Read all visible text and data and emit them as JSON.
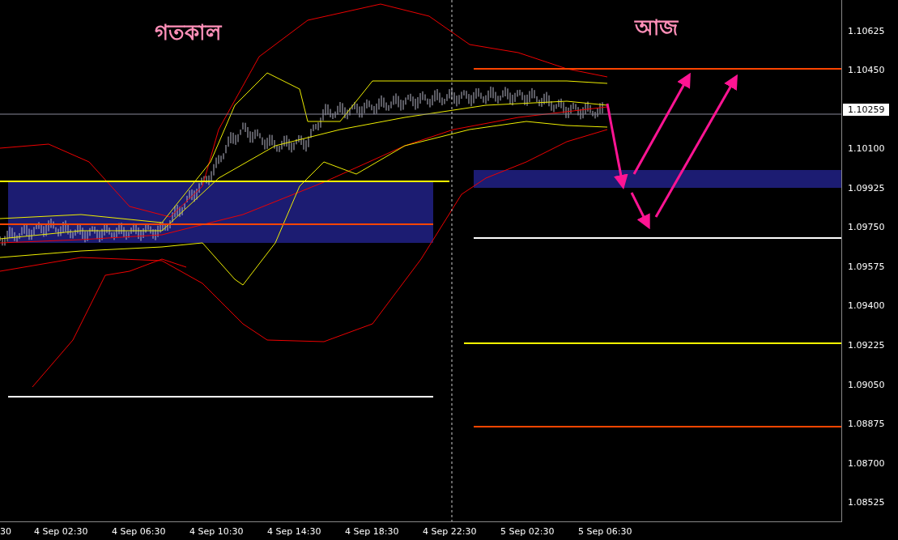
{
  "chart": {
    "annotations": [
      {
        "text": "গতকাল"
      },
      {
        "text": "আজ"
      }
    ],
    "price_axis": {
      "labels": [
        "1.10625",
        "1.10450",
        "1.10100",
        "1.09925",
        "1.09750",
        "1.09575",
        "1.09400",
        "1.09225",
        "1.09050",
        "1.08875",
        "1.08700",
        "1.08525"
      ],
      "current_price": "1.10259"
    },
    "time_axis": {
      "labels": [
        "30",
        "4 Sep 02:30",
        "4 Sep 06:30",
        "4 Sep 10:30",
        "4 Sep 14:30",
        "4 Sep 18:30",
        "4 Sep 22:30",
        "5 Sep 02:30",
        "5 Sep 06:30"
      ]
    }
  }
}
